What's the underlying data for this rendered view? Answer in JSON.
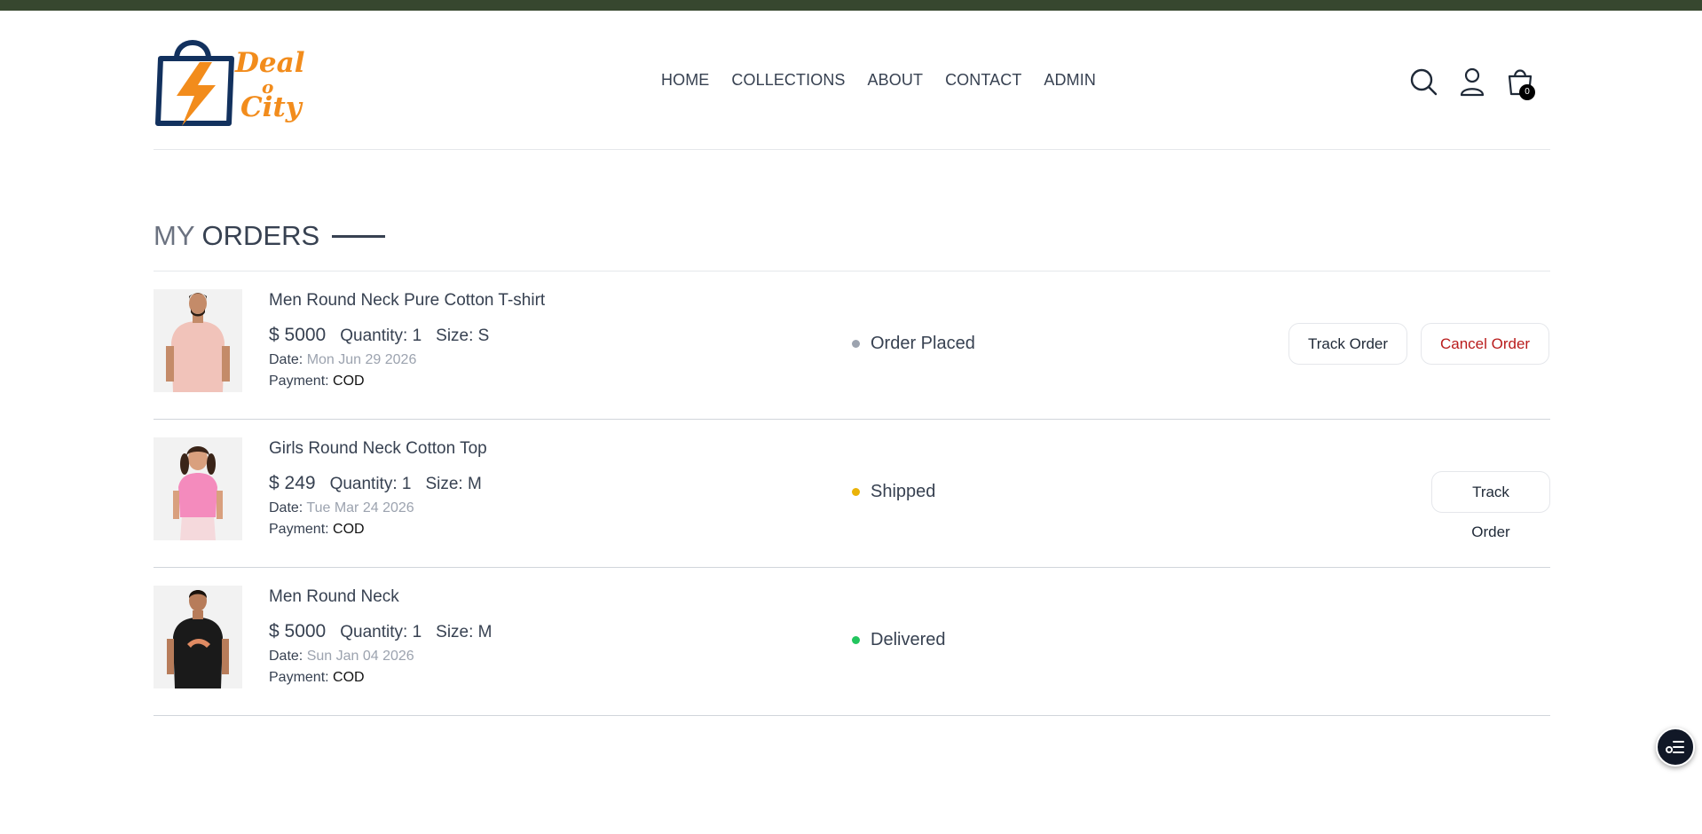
{
  "brand": {
    "logo_word1": "Deal",
    "logo_word2": "o",
    "logo_word3": "City",
    "colors": {
      "accent": "#f28c1c",
      "navy": "#12315e",
      "topbar": "#37472f"
    }
  },
  "nav": {
    "items": [
      "HOME",
      "COLLECTIONS",
      "ABOUT",
      "CONTACT",
      "ADMIN"
    ]
  },
  "header_icons": {
    "search": "search-icon",
    "profile": "user-icon",
    "cart": "shopping-bag-icon",
    "cart_count": "0"
  },
  "page": {
    "title_part1": "MY",
    "title_part2": "ORDERS"
  },
  "labels": {
    "quantity": "Quantity:",
    "size": "Size:",
    "date": "Date:",
    "payment": "Payment:"
  },
  "orders": [
    {
      "name": "Men Round Neck Pure Cotton T-shirt",
      "price": "$ 5000",
      "quantity": "1",
      "size": "S",
      "date": "Mon Jun 29 2026",
      "payment": "COD",
      "status": "Order Placed",
      "status_color": "#9ca3af",
      "track_label": "Track Order",
      "cancel_label": "Cancel Order",
      "image": "man-pink-tshirt"
    },
    {
      "name": "Girls Round Neck Cotton Top",
      "price": "$ 249",
      "quantity": "1",
      "size": "M",
      "date": "Tue Mar 24 2026",
      "payment": "COD",
      "status": "Shipped",
      "status_color": "#eab308",
      "track_label": "Track Order",
      "image": "girl-pink-top"
    },
    {
      "name": "Men Round Neck",
      "price": "$ 5000",
      "quantity": "1",
      "size": "M",
      "date": "Sun Jan 04 2026",
      "payment": "COD",
      "status": "Delivered",
      "status_color": "#22c55e",
      "image": "man-black-tshirt"
    }
  ],
  "fab": {
    "icon": "task-list-icon"
  }
}
